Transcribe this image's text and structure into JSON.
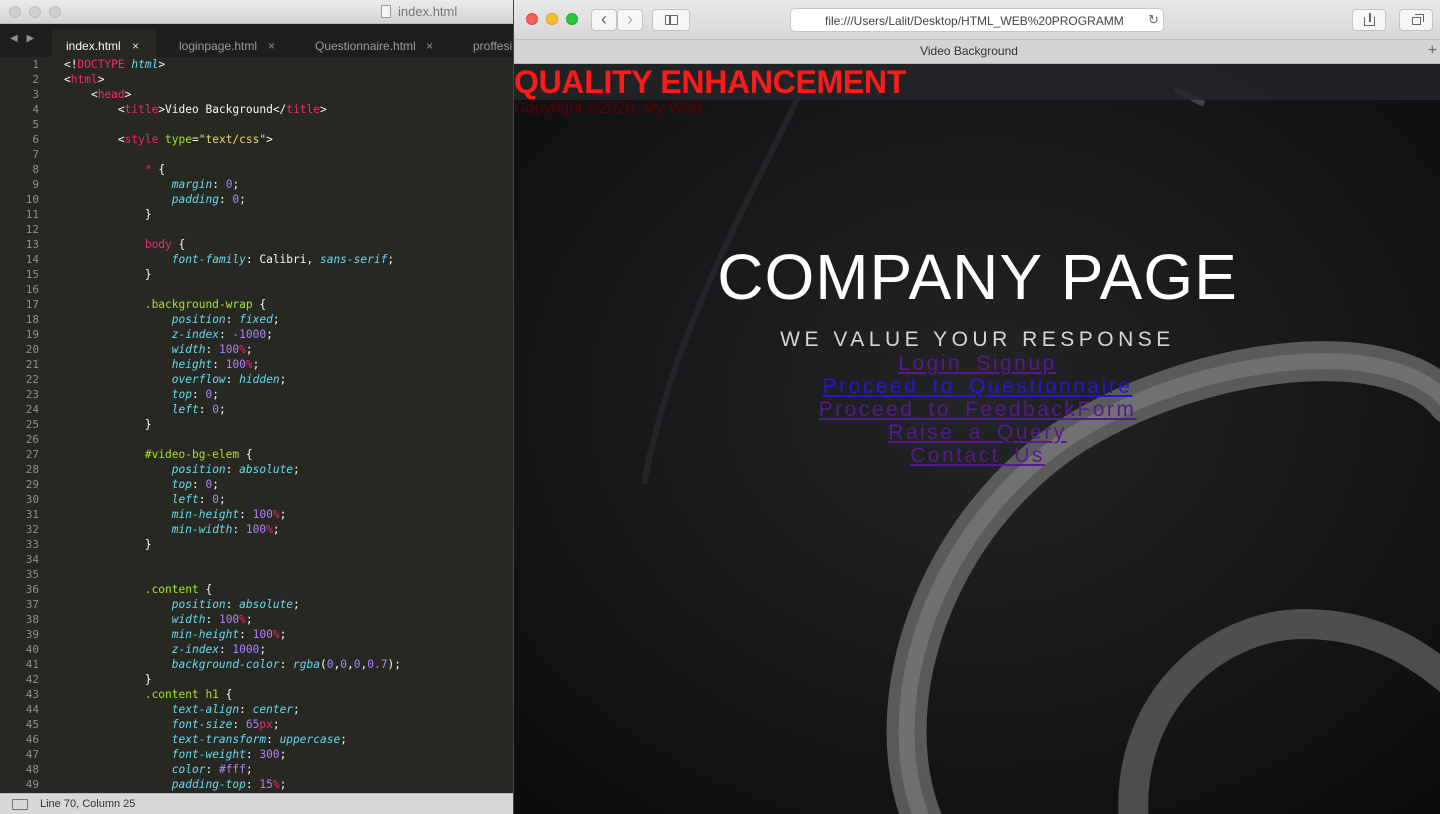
{
  "editor": {
    "window_title": "index.html",
    "nav_arrows": "◀ ▶",
    "close_glyph": "×",
    "tabs": [
      {
        "label": "index.html",
        "active": true
      },
      {
        "label": "loginpage.html",
        "active": false
      },
      {
        "label": "Questionnaire.html",
        "active": false
      },
      {
        "label": "proffesi",
        "active": false
      }
    ],
    "status": "Line 70, Column 25",
    "line_numbers": [
      "1",
      "2",
      "3",
      "4",
      "5",
      "6",
      "7",
      "8",
      "9",
      "10",
      "11",
      "12",
      "13",
      "14",
      "15",
      "16",
      "17",
      "18",
      "19",
      "20",
      "21",
      "22",
      "23",
      "24",
      "25",
      "26",
      "27",
      "28",
      "29",
      "30",
      "31",
      "32",
      "33",
      "34",
      "35",
      "36",
      "37",
      "38",
      "39",
      "40",
      "41",
      "42",
      "43",
      "44",
      "45",
      "46",
      "47",
      "48",
      "49"
    ],
    "code_lines": [
      [
        [
          "<!",
          "pw"
        ],
        [
          "DOCTYPE",
          "pk"
        ],
        [
          " html",
          "pc"
        ],
        [
          ">",
          "pw"
        ]
      ],
      [
        [
          "<",
          "pw"
        ],
        [
          "html",
          "pk"
        ],
        [
          ">",
          "pw"
        ]
      ],
      [
        [
          "    <",
          "pw"
        ],
        [
          "head",
          "pk"
        ],
        [
          ">",
          "pw"
        ]
      ],
      [
        [
          "        <",
          "pw"
        ],
        [
          "title",
          "pk"
        ],
        [
          ">Video Background</",
          "pw"
        ],
        [
          "title",
          "pk"
        ],
        [
          ">",
          "pw"
        ]
      ],
      [],
      [
        [
          "        <",
          "pw"
        ],
        [
          "style",
          "pk"
        ],
        [
          " type",
          "pg"
        ],
        [
          "=",
          "pw"
        ],
        [
          "\"text/css\"",
          "py"
        ],
        [
          ">",
          "pw"
        ]
      ],
      [],
      [
        [
          "            ",
          "pw"
        ],
        [
          "*",
          "pk"
        ],
        [
          " {",
          "pw"
        ]
      ],
      [
        [
          "                ",
          "pw"
        ],
        [
          "margin",
          "pc"
        ],
        [
          ": ",
          "pw"
        ],
        [
          "0",
          "pp"
        ],
        [
          ";",
          "pw"
        ]
      ],
      [
        [
          "                ",
          "pw"
        ],
        [
          "padding",
          "pc"
        ],
        [
          ": ",
          "pw"
        ],
        [
          "0",
          "pp"
        ],
        [
          ";",
          "pw"
        ]
      ],
      [
        [
          "            }",
          "pw"
        ]
      ],
      [],
      [
        [
          "            ",
          "pw"
        ],
        [
          "body",
          "pk"
        ],
        [
          " {",
          "pw"
        ]
      ],
      [
        [
          "                ",
          "pw"
        ],
        [
          "font-family",
          "pc"
        ],
        [
          ": Calibri, ",
          "pw"
        ],
        [
          "sans-serif",
          "pc"
        ],
        [
          ";",
          "pw"
        ]
      ],
      [
        [
          "            }",
          "pw"
        ]
      ],
      [],
      [
        [
          "            ",
          "pw"
        ],
        [
          ".background-wrap",
          "pg"
        ],
        [
          " {",
          "pw"
        ]
      ],
      [
        [
          "                ",
          "pw"
        ],
        [
          "position",
          "pc"
        ],
        [
          ": ",
          "pw"
        ],
        [
          "fixed",
          "pc"
        ],
        [
          ";",
          "pw"
        ]
      ],
      [
        [
          "                ",
          "pw"
        ],
        [
          "z-index",
          "pc"
        ],
        [
          ": ",
          "pw"
        ],
        [
          "-1000",
          "pp"
        ],
        [
          ";",
          "pw"
        ]
      ],
      [
        [
          "                ",
          "pw"
        ],
        [
          "width",
          "pc"
        ],
        [
          ": ",
          "pw"
        ],
        [
          "100",
          "pp"
        ],
        [
          "%",
          "pk"
        ],
        [
          ";",
          "pw"
        ]
      ],
      [
        [
          "                ",
          "pw"
        ],
        [
          "height",
          "pc"
        ],
        [
          ": ",
          "pw"
        ],
        [
          "100",
          "pp"
        ],
        [
          "%",
          "pk"
        ],
        [
          ";",
          "pw"
        ]
      ],
      [
        [
          "                ",
          "pw"
        ],
        [
          "overflow",
          "pc"
        ],
        [
          ": ",
          "pw"
        ],
        [
          "hidden",
          "pc"
        ],
        [
          ";",
          "pw"
        ]
      ],
      [
        [
          "                ",
          "pw"
        ],
        [
          "top",
          "pc"
        ],
        [
          ": ",
          "pw"
        ],
        [
          "0",
          "pp"
        ],
        [
          ";",
          "pw"
        ]
      ],
      [
        [
          "                ",
          "pw"
        ],
        [
          "left",
          "pc"
        ],
        [
          ": ",
          "pw"
        ],
        [
          "0",
          "pp"
        ],
        [
          ";",
          "pw"
        ]
      ],
      [
        [
          "            }",
          "pw"
        ]
      ],
      [],
      [
        [
          "            ",
          "pw"
        ],
        [
          "#video-bg-elem",
          "pg"
        ],
        [
          " {",
          "pw"
        ]
      ],
      [
        [
          "                ",
          "pw"
        ],
        [
          "position",
          "pc"
        ],
        [
          ": ",
          "pw"
        ],
        [
          "absolute",
          "pc"
        ],
        [
          ";",
          "pw"
        ]
      ],
      [
        [
          "                ",
          "pw"
        ],
        [
          "top",
          "pc"
        ],
        [
          ": ",
          "pw"
        ],
        [
          "0",
          "pp"
        ],
        [
          ";",
          "pw"
        ]
      ],
      [
        [
          "                ",
          "pw"
        ],
        [
          "left",
          "pc"
        ],
        [
          ": ",
          "pw"
        ],
        [
          "0",
          "pp"
        ],
        [
          ";",
          "pw"
        ]
      ],
      [
        [
          "                ",
          "pw"
        ],
        [
          "min-height",
          "pc"
        ],
        [
          ": ",
          "pw"
        ],
        [
          "100",
          "pp"
        ],
        [
          "%",
          "pk"
        ],
        [
          ";",
          "pw"
        ]
      ],
      [
        [
          "                ",
          "pw"
        ],
        [
          "min-width",
          "pc"
        ],
        [
          ": ",
          "pw"
        ],
        [
          "100",
          "pp"
        ],
        [
          "%",
          "pk"
        ],
        [
          ";",
          "pw"
        ]
      ],
      [
        [
          "            }",
          "pw"
        ]
      ],
      [],
      [],
      [
        [
          "            ",
          "pw"
        ],
        [
          ".content",
          "pg"
        ],
        [
          " {",
          "pw"
        ]
      ],
      [
        [
          "                ",
          "pw"
        ],
        [
          "position",
          "pc"
        ],
        [
          ": ",
          "pw"
        ],
        [
          "absolute",
          "pc"
        ],
        [
          ";",
          "pw"
        ]
      ],
      [
        [
          "                ",
          "pw"
        ],
        [
          "width",
          "pc"
        ],
        [
          ": ",
          "pw"
        ],
        [
          "100",
          "pp"
        ],
        [
          "%",
          "pk"
        ],
        [
          ";",
          "pw"
        ]
      ],
      [
        [
          "                ",
          "pw"
        ],
        [
          "min-height",
          "pc"
        ],
        [
          ": ",
          "pw"
        ],
        [
          "100",
          "pp"
        ],
        [
          "%",
          "pk"
        ],
        [
          ";",
          "pw"
        ]
      ],
      [
        [
          "                ",
          "pw"
        ],
        [
          "z-index",
          "pc"
        ],
        [
          ": ",
          "pw"
        ],
        [
          "1000",
          "pp"
        ],
        [
          ";",
          "pw"
        ]
      ],
      [
        [
          "                ",
          "pw"
        ],
        [
          "background-color",
          "pc"
        ],
        [
          ": ",
          "pw"
        ],
        [
          "rgba",
          "pc"
        ],
        [
          "(",
          "pw"
        ],
        [
          "0",
          "pp"
        ],
        [
          ",",
          "pw"
        ],
        [
          "0",
          "pp"
        ],
        [
          ",",
          "pw"
        ],
        [
          "0",
          "pp"
        ],
        [
          ",",
          "pw"
        ],
        [
          "0.7",
          "pp"
        ],
        [
          ");",
          "pw"
        ]
      ],
      [
        [
          "            }",
          "pw"
        ]
      ],
      [
        [
          "            ",
          "pw"
        ],
        [
          ".content h1",
          "pg"
        ],
        [
          " {",
          "pw"
        ]
      ],
      [
        [
          "                ",
          "pw"
        ],
        [
          "text-align",
          "pc"
        ],
        [
          ": ",
          "pw"
        ],
        [
          "center",
          "pc"
        ],
        [
          ";",
          "pw"
        ]
      ],
      [
        [
          "                ",
          "pw"
        ],
        [
          "font-size",
          "pc"
        ],
        [
          ": ",
          "pw"
        ],
        [
          "65",
          "pp"
        ],
        [
          "px",
          "pk"
        ],
        [
          ";",
          "pw"
        ]
      ],
      [
        [
          "                ",
          "pw"
        ],
        [
          "text-transform",
          "pc"
        ],
        [
          ": ",
          "pw"
        ],
        [
          "uppercase",
          "pc"
        ],
        [
          ";",
          "pw"
        ]
      ],
      [
        [
          "                ",
          "pw"
        ],
        [
          "font-weight",
          "pc"
        ],
        [
          ": ",
          "pw"
        ],
        [
          "300",
          "pp"
        ],
        [
          ";",
          "pw"
        ]
      ],
      [
        [
          "                ",
          "pw"
        ],
        [
          "color",
          "pc"
        ],
        [
          ": ",
          "pw"
        ],
        [
          "#fff",
          "pp"
        ],
        [
          ";",
          "pw"
        ]
      ],
      [
        [
          "                ",
          "pw"
        ],
        [
          "padding-top",
          "pc"
        ],
        [
          ": ",
          "pw"
        ],
        [
          "15",
          "pp"
        ],
        [
          "%",
          "pk"
        ],
        [
          ";",
          "pw"
        ]
      ]
    ]
  },
  "browser": {
    "url": "file:///Users/Lalit/Desktop/HTML_WEB%20PROGRAMM",
    "tab_title": "Video Background",
    "new_tab_glyph": "+",
    "back_glyph": "‹",
    "forward_glyph": "›",
    "reload_glyph": "↻"
  },
  "page": {
    "brand": "QUALITY ENHANCEMENT",
    "copyright": "Copyright ©2020, My Web",
    "hero_title": "COMPANY PAGE",
    "hero_subtitle": "WE VALUE YOUR RESPONSE",
    "links": [
      {
        "label": "Login_Signup",
        "visited": true
      },
      {
        "label": "Proceed_to_Questionnaire",
        "visited": false
      },
      {
        "label": "Proceed_to_FeedbackForm",
        "visited": true
      },
      {
        "label": "Raise_a_Query",
        "visited": true
      },
      {
        "label": "Contact_Us",
        "visited": true
      }
    ]
  },
  "colors": {
    "brand_red": "#ff1a1a",
    "visited_link": "#551a8b",
    "unvisited_link": "#2a14d8",
    "editor_bg": "#272822"
  }
}
